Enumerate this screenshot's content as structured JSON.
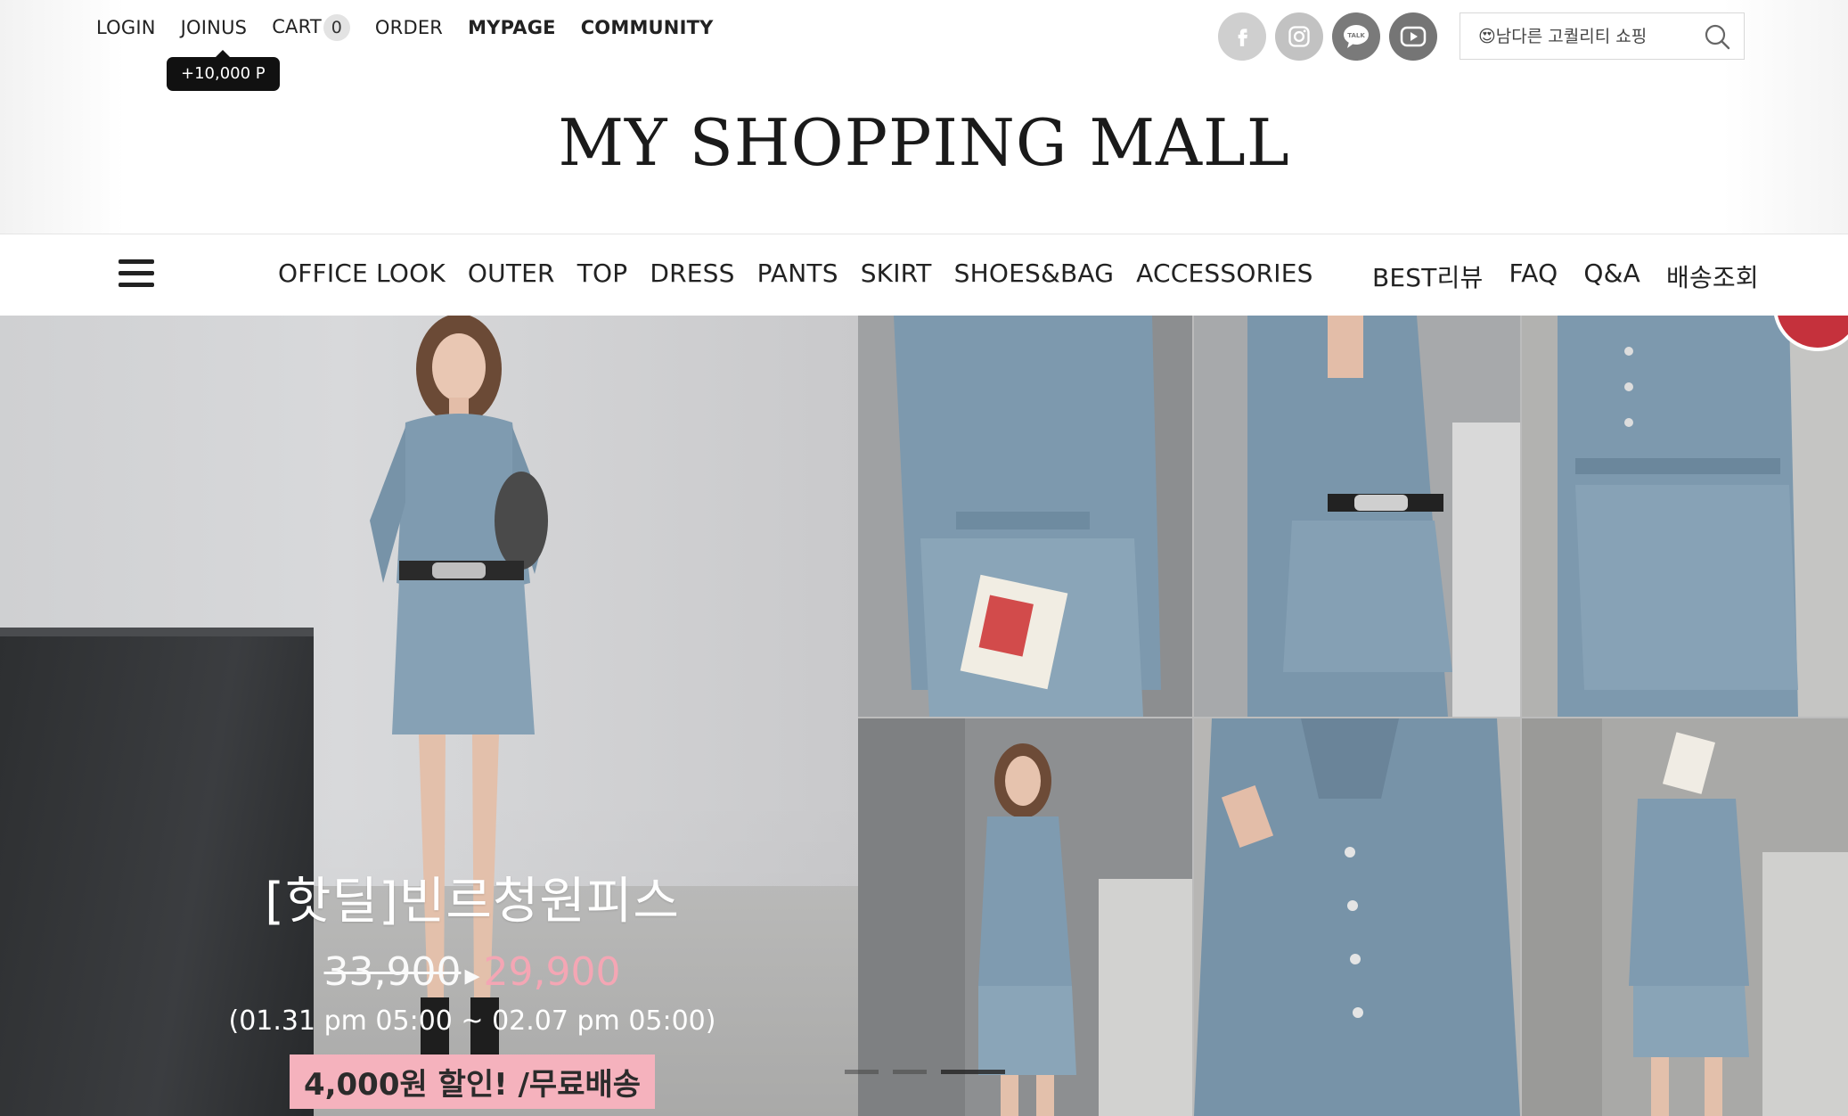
{
  "topbar": {
    "links": {
      "login": "LOGIN",
      "joinus": "JOINUS",
      "cart": "CART",
      "cart_count": "0",
      "order": "ORDER",
      "mypage": "MYPAGE",
      "community": "COMMUNITY"
    },
    "join_tooltip": "+10,000 P",
    "social_icons": [
      "facebook-icon",
      "instagram-icon",
      "kakaotalk-icon",
      "youtube-icon"
    ],
    "search": {
      "placeholder": "😍남다른 고퀄리티 쇼핑",
      "icon": "search-icon"
    }
  },
  "logo": "MY SHOPPING MALL",
  "nav": {
    "menu_icon": "hamburger-menu-icon",
    "main": [
      "OFFICE LOOK",
      "OUTER",
      "TOP",
      "DRESS",
      "PANTS",
      "SKIRT",
      "SHOES&BAG",
      "ACCESSORIES"
    ],
    "right": [
      "BEST리뷰",
      "FAQ",
      "Q&A",
      "배송조회"
    ]
  },
  "hero": {
    "title": "[핫딜]빈르청원피스",
    "old_price": "33,900",
    "arrow": "▸",
    "new_price": "29,900",
    "period": "(01.31 pm 05:00 ~ 02.07 pm 05:00)",
    "badge": "4,000원 할인! /무료배송",
    "slides_total": 3,
    "active_slide": 3
  },
  "colors": {
    "accent_pink": "#f4a6b4",
    "badge_pink": "#f5b2bd",
    "text_dark": "#222222",
    "corner_badge_red": "#c5313c"
  }
}
